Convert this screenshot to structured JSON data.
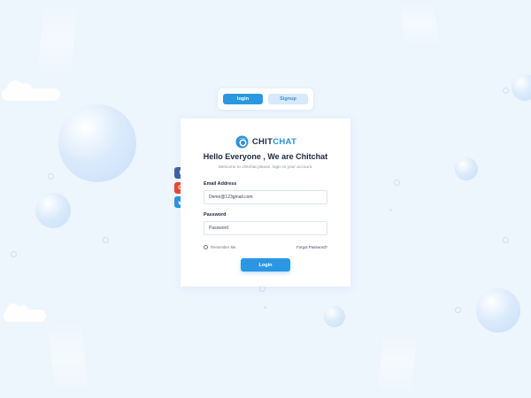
{
  "tabs": [
    {
      "label": "login",
      "active": true
    },
    {
      "label": "Signup",
      "active": false
    }
  ],
  "brand": {
    "name_main": "CHIT",
    "name_accent": "CHAT",
    "logo_icon": "chat-bubble-icon"
  },
  "header": {
    "title": "Hello Everyone , We are Chitchat",
    "subtitle": "Welcome to chitchat please, login to your account."
  },
  "form": {
    "email": {
      "label": "Email Address",
      "value": "Demo@123gmail.com"
    },
    "password": {
      "label": "Password",
      "placeholder": "Password"
    },
    "remember_label": "Remember Me.",
    "forgot_label": "Forgot Password?",
    "submit_label": "Login"
  },
  "social": [
    {
      "name": "facebook-icon",
      "glyph": "f",
      "color": "#3c5fa6"
    },
    {
      "name": "google-icon",
      "glyph": "G",
      "color": "#e5462f"
    },
    {
      "name": "twitter-icon",
      "glyph": "t",
      "color": "#2a93e0"
    }
  ],
  "colors": {
    "primary": "#2b97e3",
    "background": "#edf5fd",
    "heading": "#1e2740"
  }
}
